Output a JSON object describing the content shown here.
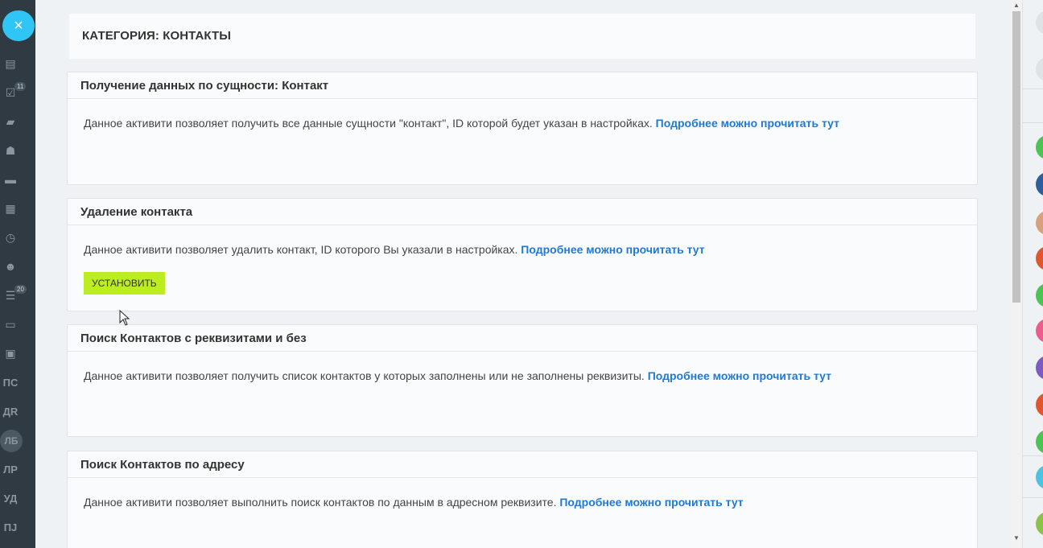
{
  "sidebar": {
    "close_label": "×",
    "tasks_badge": "11",
    "filter_badge": "20",
    "user_initials": [
      "ПС",
      "ДR",
      "ЛБ",
      "ЛР",
      "УД",
      "ПJ"
    ]
  },
  "header": {
    "title": "КАТЕГОРИЯ: КОНТАКТЫ"
  },
  "cards": [
    {
      "title": "Получение данных по сущности: Контакт",
      "text": "Данное активити позволяет получить все данные сущности \"контакт\", ID которой будет указан в настройках.",
      "link": "Подробнее можно прочитать тут"
    },
    {
      "title": "Удаление контакта",
      "text": "Данное активити позволяет удалить контакт, ID которого Вы указали в настройках.",
      "link": "Подробнее можно прочитать тут",
      "button": "УСТАНОВИТЬ"
    },
    {
      "title": "Поиск Контактов с реквизитами и без",
      "text": "Данное активити позволяет получить список контактов у которых заполнены или не заполнены реквизиты.",
      "link": "Подробнее можно прочитать тут"
    },
    {
      "title": "Поиск Контактов по адресу",
      "text": "Данное активити позволяет выполнить поиск контактов по данным в адресном реквизите.",
      "link": "Подробнее можно прочитать тут"
    }
  ],
  "colors": {
    "accent": "#2fc6f6",
    "install_button": "#bbed21",
    "link": "#1e7ad6",
    "sidebar_bg": "#2f3a42"
  }
}
